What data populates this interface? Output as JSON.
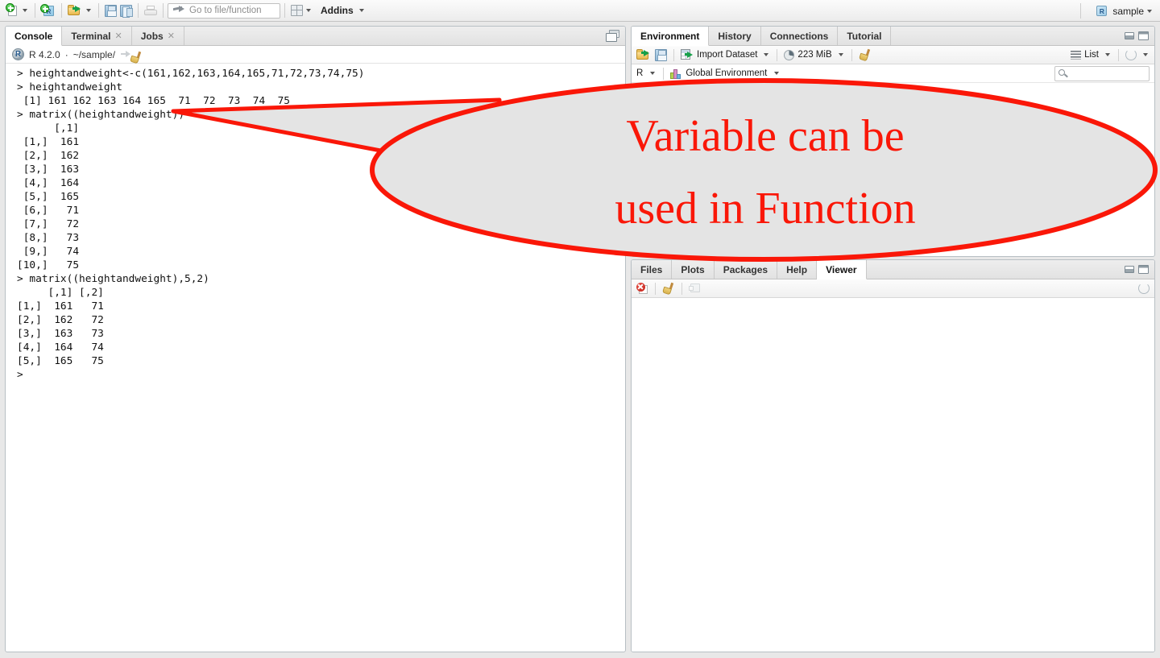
{
  "toolbar": {
    "new_file_label": "new-file",
    "new_project_label": "new-project",
    "open_label": "open-file",
    "save_label": "save",
    "save_all_label": "save-all",
    "print_label": "print",
    "goto_placeholder": "Go to file/function",
    "panes_label": "workspace-panes",
    "addins_label": "Addins",
    "project_name": "sample"
  },
  "console": {
    "tabs": [
      {
        "label": "Console",
        "active": true,
        "closable": false
      },
      {
        "label": "Terminal",
        "active": false,
        "closable": true
      },
      {
        "label": "Jobs",
        "active": false,
        "closable": true
      }
    ],
    "r_version": "R 4.2.0",
    "separator": "·",
    "working_dir": "~/sample/",
    "output": "> heightandweight<-c(161,162,163,164,165,71,72,73,74,75)\n> heightandweight\n [1] 161 162 163 164 165  71  72  73  74  75\n> matrix((heightandweight))\n      [,1]\n [1,]  161\n [2,]  162\n [3,]  163\n [4,]  164\n [5,]  165\n [6,]   71\n [7,]   72\n [8,]   73\n [9,]   74\n[10,]   75\n> matrix((heightandweight),5,2)\n     [,1] [,2]\n[1,]  161   71\n[2,]  162   72\n[3,]  163   73\n[4,]  164   74\n[5,]  165   75\n> "
  },
  "environment": {
    "tabs": [
      {
        "label": "Environment",
        "active": true
      },
      {
        "label": "History",
        "active": false
      },
      {
        "label": "Connections",
        "active": false
      },
      {
        "label": "Tutorial",
        "active": false
      }
    ],
    "toolbar": {
      "load_label": "load-workspace",
      "save_label": "save-workspace",
      "import_dataset": "Import Dataset",
      "memory_usage": "223 MiB",
      "clear_label": "clear-objects",
      "view_mode": "List",
      "refresh_label": "refresh"
    },
    "scope": {
      "language": "R",
      "env_name": "Global Environment"
    },
    "search_placeholder": ""
  },
  "viewer": {
    "tabs": [
      {
        "label": "Files",
        "active": false
      },
      {
        "label": "Plots",
        "active": false
      },
      {
        "label": "Packages",
        "active": false
      },
      {
        "label": "Help",
        "active": false
      },
      {
        "label": "Viewer",
        "active": true
      }
    ],
    "toolbar": {
      "stop_label": "stop-server",
      "clear_label": "clear-viewer",
      "popout_label": "show-in-new-window",
      "refresh_label": "refresh-viewer"
    }
  },
  "annotation": {
    "line1": "Variable can be",
    "line2": "used in Function",
    "color": "#fa1708",
    "fill": "#e4e4e4"
  }
}
